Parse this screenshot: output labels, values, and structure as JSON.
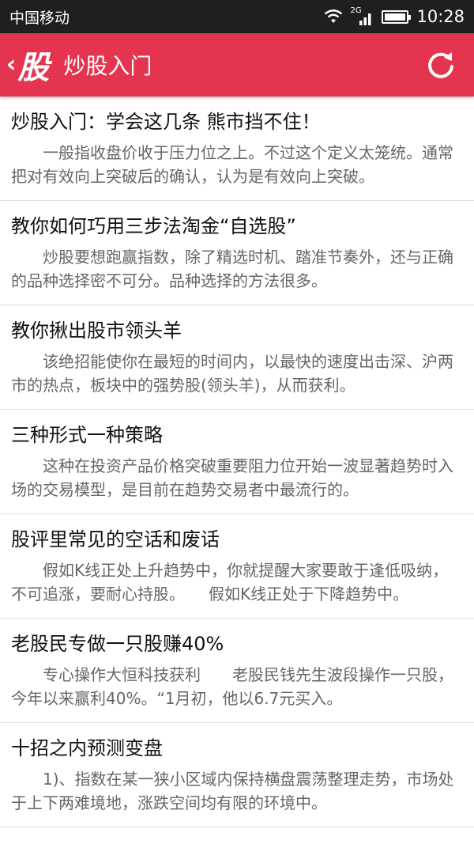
{
  "status_bar": {
    "carrier": "中国移动",
    "network_type": "2G",
    "time": "10:28"
  },
  "header": {
    "back_icon": "back-chevron-icon",
    "logo_text": "股",
    "title": "炒股入门",
    "refresh_icon": "refresh-icon"
  },
  "colors": {
    "header_bg": "#e4344f",
    "status_bg": "#1f1f1f",
    "title_text": "#111111",
    "summary_text": "#666666"
  },
  "articles": [
    {
      "title": "炒股入门：学会这几条 熊市挡不住！",
      "summary": "一般指收盘价收于压力位之上。不过这个定义太笼统。通常把对有效向上突破后的确认，认为是有效向上突破。"
    },
    {
      "title": "教你如何巧用三步法淘金“自选股”",
      "summary": "炒股要想跑赢指数，除了精选时机、踏准节奏外，还与正确的品种选择密不可分。品种选择的方法很多。"
    },
    {
      "title": "教你揪出股市领头羊",
      "summary": "该绝招能使你在最短的时间内，以最快的速度出击深、沪两市的热点，板块中的强势股(领头羊)，从而获利。"
    },
    {
      "title": "三种形式一种策略",
      "summary": "这种在投资产品价格突破重要阻力位开始一波显著趋势时入场的交易模型，是目前在趋势交易者中最流行的。"
    },
    {
      "title": "股评里常见的空话和废话",
      "summary": "假如K线正处上升趋势中，你就提醒大家要敢于逢低吸纳，不可追涨，要耐心持股。　　假如K线正处于下降趋势中。"
    },
    {
      "title": "老股民专做一只股赚40%",
      "summary": "专心操作大恒科技获利　　老股民钱先生波段操作一只股，今年以来赢利40%。“1月初，他以6.7元买入。"
    },
    {
      "title": "十招之内预测变盘",
      "summary": "1)、指数在某一狭小区域内保持横盘震荡整理走势，市场处于上下两难境地，涨跌空间均有限的环境中。"
    }
  ]
}
